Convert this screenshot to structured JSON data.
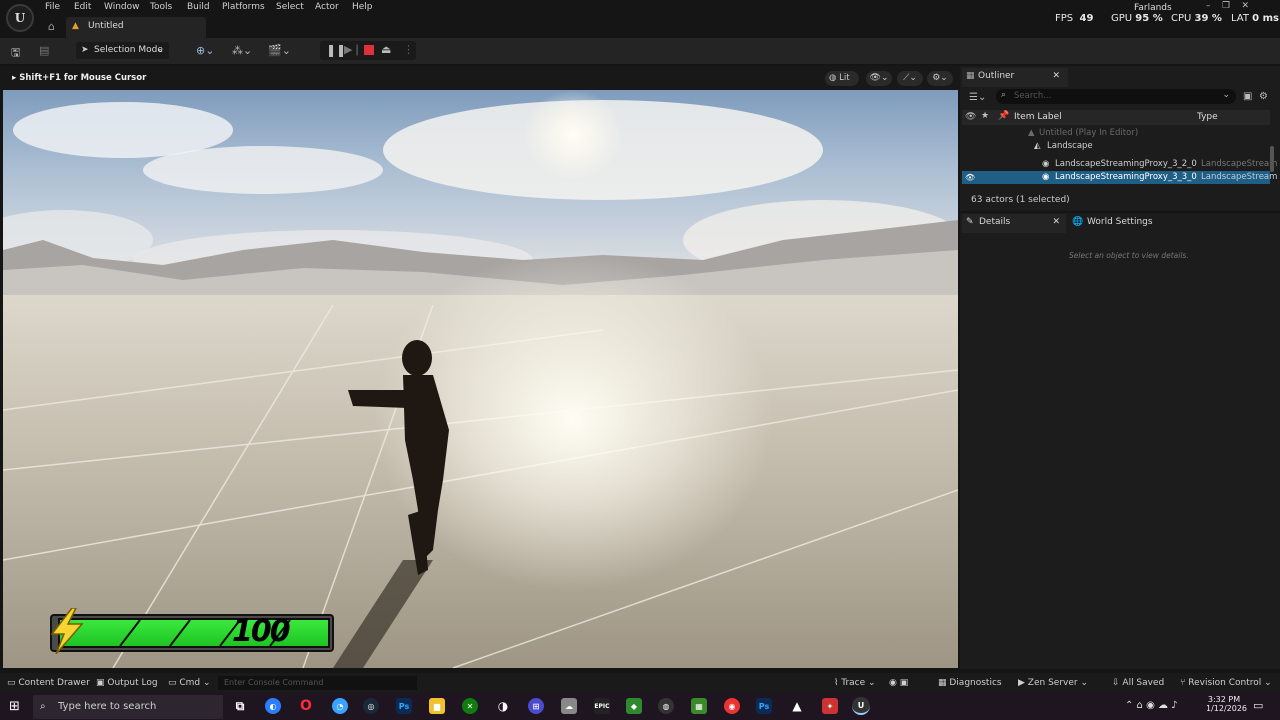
{
  "titlebar": {
    "logo": "U",
    "menu": [
      "File",
      "Edit",
      "Window",
      "Tools",
      "Build",
      "Platforms",
      "Select",
      "Actor",
      "Help"
    ],
    "tab_title": "Untitled",
    "project": "Farlands",
    "stats": {
      "fps_label": "FPS",
      "fps_value": "49",
      "gpu_label": "GPU",
      "gpu_value": "95 %",
      "cpu_label": "CPU",
      "cpu_value": "39 %",
      "lat_label": "LAT",
      "lat_value": "0 ms"
    }
  },
  "toolbar": {
    "selection_mode": "Selection Mode",
    "icons": [
      "save-icon",
      "content-icon",
      "add-actor-icon",
      "blueprint-icon",
      "cinematics-icon",
      "pause-icon",
      "skip-icon",
      "stop-icon",
      "eject-icon",
      "more-icon"
    ]
  },
  "viewport": {
    "hint": "Shift+F1 for Mouse Cursor",
    "lit_label": "Lit",
    "hud": {
      "health_value": "100",
      "fill_fraction": 1.0
    }
  },
  "outliner": {
    "tab_label": "Outliner",
    "search_placeholder": "Search...",
    "col_item_label": "Item Label",
    "col_type": "Type",
    "rows": [
      {
        "label": "Untitled (Play In Editor)",
        "type": "",
        "indent": 0
      },
      {
        "label": "Landscape",
        "type": "",
        "indent": 1
      },
      {
        "label": "LandscapeStreamingProxy_3_2_0",
        "type": "LandscapeStream",
        "indent": 2
      },
      {
        "label": "LandscapeStreamingProxy_3_3_0",
        "type": "LandscapeStream",
        "indent": 2
      }
    ],
    "footer": "63 actors (1 selected)"
  },
  "details": {
    "tab_label": "Details",
    "world_settings_label": "World Settings",
    "empty_text": "Select an object to view details."
  },
  "statusbar": {
    "content_drawer": "Content Drawer",
    "output_log": "Output Log",
    "cmd": "Cmd",
    "console_placeholder": "Enter Console Command",
    "trace": "Trace",
    "diagnostics": "Diagnostics",
    "zen_server": "Zen Server",
    "all_saved": "All Saved",
    "revision_control": "Revision Control"
  },
  "taskbar": {
    "search_placeholder": "Type here to search",
    "time": "3:32 PM",
    "date": "1/12/2026"
  },
  "colors": {
    "selected_row": "#1f5f86",
    "health_green": "#2bd630",
    "stop_red": "#e0303a"
  }
}
